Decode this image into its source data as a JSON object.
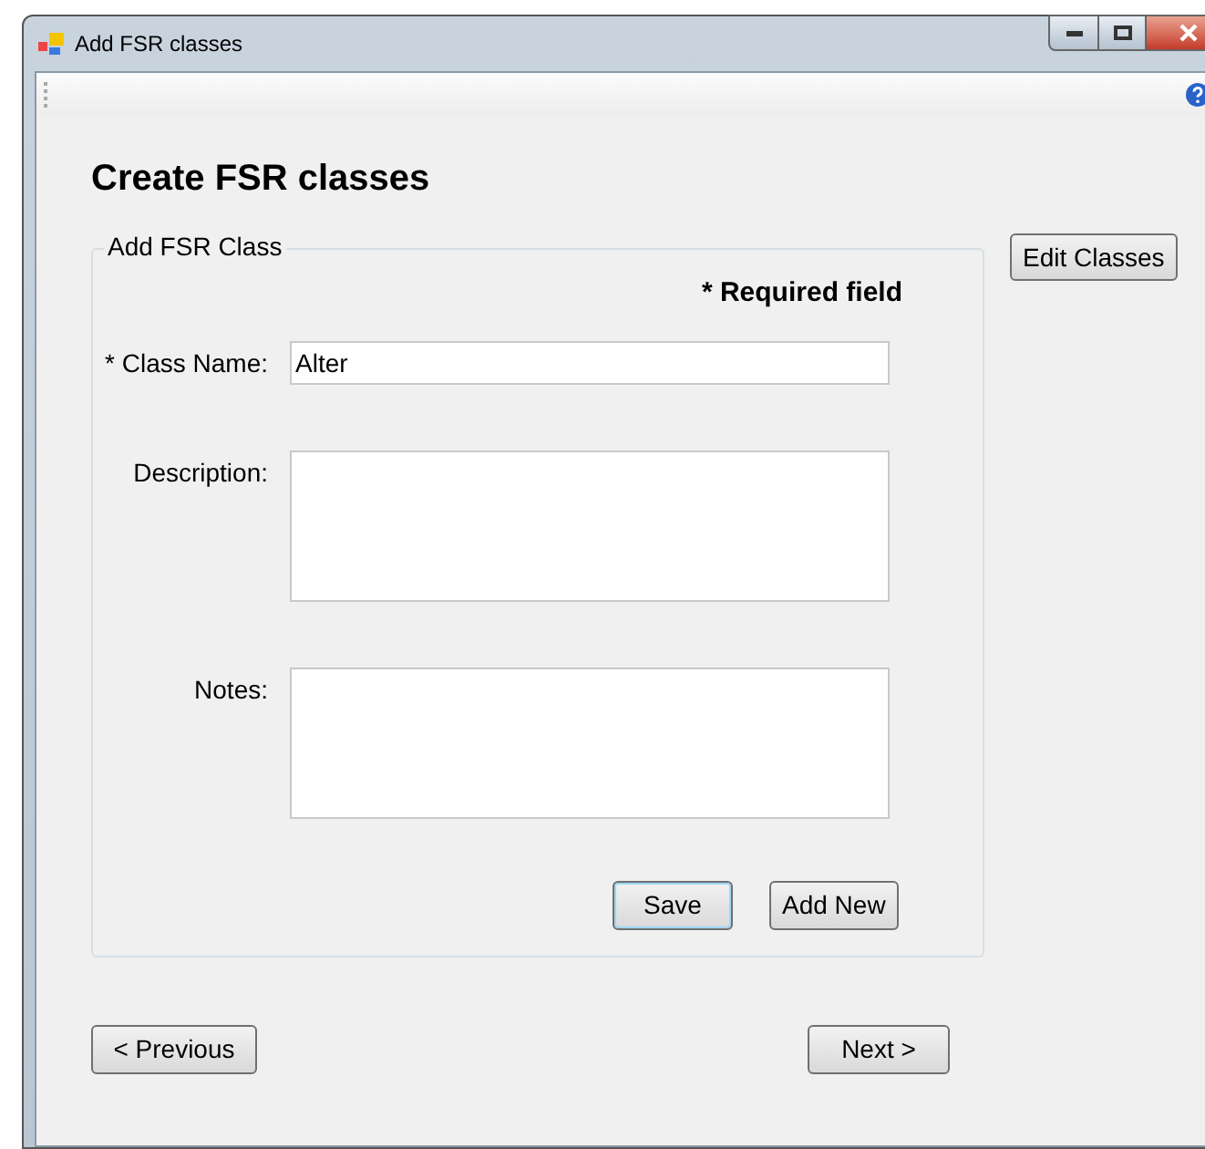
{
  "window": {
    "title": "Add FSR classes"
  },
  "heading": "Create FSR classes",
  "group": {
    "title": "Add FSR Class",
    "required_note": "* Required field",
    "fields": [
      {
        "label": "* Class Name:",
        "value": "Alter",
        "kind": "single"
      },
      {
        "label": "Description:",
        "kind": "multi"
      },
      {
        "label": "Notes:",
        "kind": "multi"
      }
    ],
    "buttons": [
      {
        "label": "Save",
        "focused": true
      },
      {
        "label": "Add New",
        "focused": false
      }
    ]
  },
  "side_button": "Edit Classes",
  "nav": {
    "previous": "< Previous",
    "next": "Next >"
  }
}
